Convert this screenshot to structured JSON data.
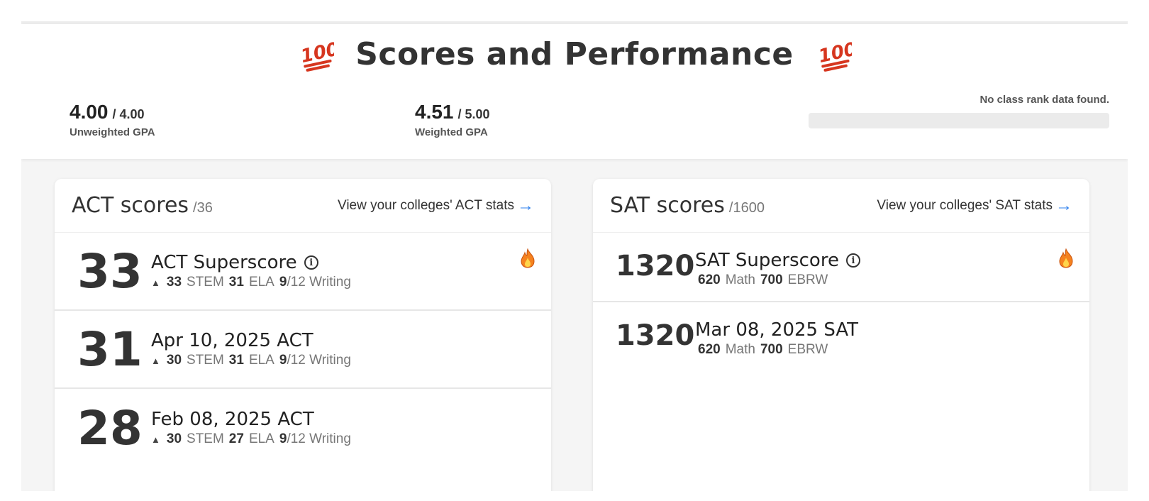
{
  "header": {
    "title": "Scores and Performance",
    "emoji_left": "100-emoji-icon",
    "emoji_right": "100-emoji-icon"
  },
  "gpa": {
    "unweighted": {
      "value": "4.00",
      "of": "/ 4.00",
      "label": "Unweighted GPA"
    },
    "weighted": {
      "value": "4.51",
      "of": "/ 5.00",
      "label": "Weighted GPA"
    }
  },
  "class_rank": {
    "message": "No class rank data found."
  },
  "act": {
    "title": "ACT scores",
    "max": "/36",
    "link": "View your colleges' ACT stats",
    "rows": [
      {
        "score": "33",
        "title": "ACT Superscore",
        "stem": "33",
        "stem_label": "STEM",
        "ela": "31",
        "ela_label": "ELA",
        "writing": "9",
        "writing_label": "/12 Writing"
      },
      {
        "score": "31",
        "title": "Apr 10, 2025 ACT",
        "stem": "30",
        "stem_label": "STEM",
        "ela": "31",
        "ela_label": "ELA",
        "writing": "9",
        "writing_label": "/12 Writing"
      },
      {
        "score": "28",
        "title": "Feb 08, 2025 ACT",
        "stem": "30",
        "stem_label": "STEM",
        "ela": "27",
        "ela_label": "ELA",
        "writing": "9",
        "writing_label": "/12 Writing"
      }
    ]
  },
  "sat": {
    "title": "SAT scores",
    "max": "/1600",
    "link": "View your colleges' SAT stats",
    "rows": [
      {
        "score": "1320",
        "title": "SAT Superscore",
        "math": "620",
        "math_label": "Math",
        "ebrw": "700",
        "ebrw_label": "EBRW"
      },
      {
        "score": "1320",
        "title": "Mar 08, 2025 SAT",
        "math": "620",
        "math_label": "Math",
        "ebrw": "700",
        "ebrw_label": "EBRW"
      }
    ]
  },
  "colors": {
    "link_arrow": "#2f80ed",
    "emoji_red": "#d6361f",
    "flame_orange": "#f5821f"
  }
}
